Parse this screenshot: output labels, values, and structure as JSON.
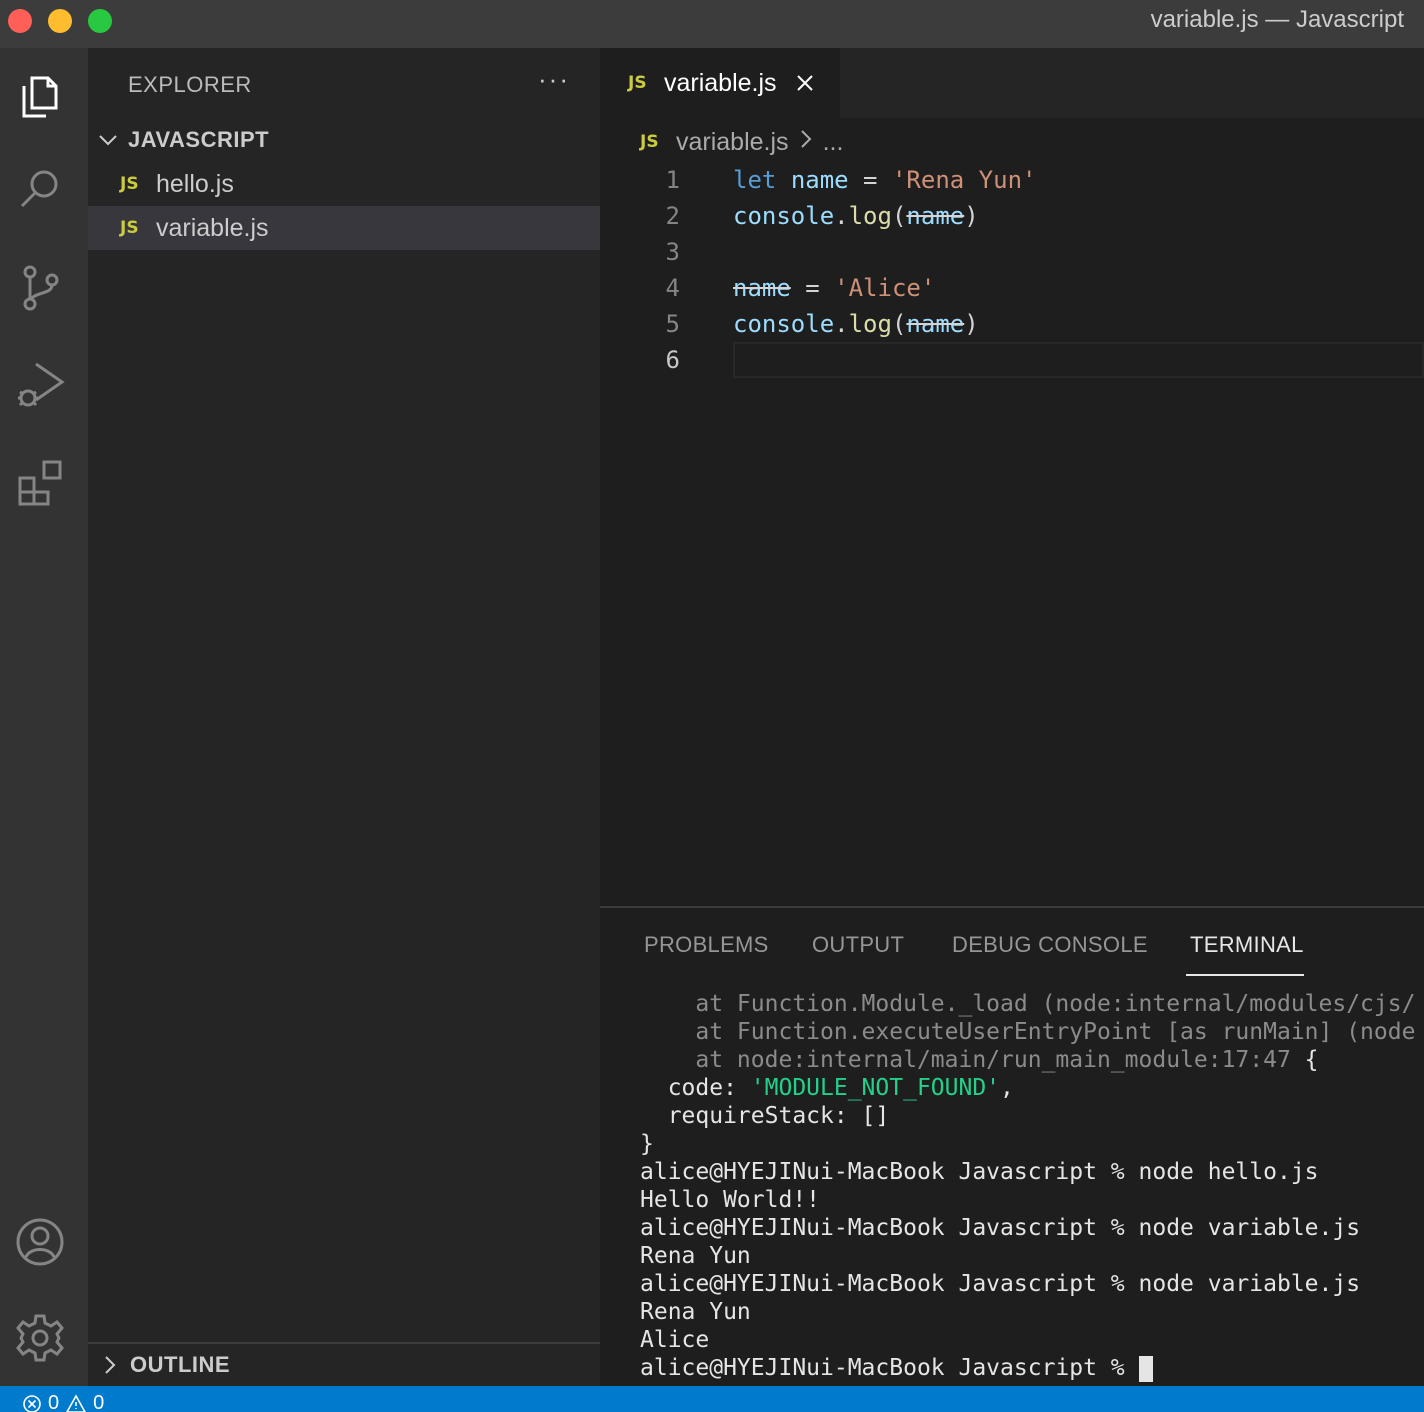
{
  "window": {
    "title": "variable.js — Javascript"
  },
  "sidebar": {
    "header": "EXPLORER",
    "more": "···",
    "folder": "JAVASCRIPT",
    "files": [
      {
        "badge": "JS",
        "name": "hello.js"
      },
      {
        "badge": "JS",
        "name": "variable.js"
      }
    ],
    "outline": "OUTLINE"
  },
  "editor": {
    "tab": {
      "badge": "JS",
      "name": "variable.js"
    },
    "breadcrumb": {
      "badge": "JS",
      "file": "variable.js",
      "rest": "..."
    },
    "line_numbers": [
      "1",
      "2",
      "3",
      "4",
      "5",
      "6"
    ],
    "code": {
      "l1": {
        "kw": "let",
        "var": "name",
        "op": " = ",
        "str": "'Rena Yun'"
      },
      "l2": {
        "obj": "console",
        "dot": ".",
        "fn": "log",
        "open": "(",
        "arg": "name",
        "close": ")"
      },
      "l4": {
        "var": "name",
        "op": " = ",
        "str": "'Alice'"
      },
      "l5": {
        "obj": "console",
        "dot": ".",
        "fn": "log",
        "open": "(",
        "arg": "name",
        "close": ")"
      }
    }
  },
  "panel": {
    "tabs": [
      "PROBLEMS",
      "OUTPUT",
      "DEBUG CONSOLE",
      "TERMINAL"
    ],
    "active_tab": "TERMINAL",
    "terminal": {
      "l1": "    at Function.Module._load (node:internal/modules/cjs/",
      "l2": "    at Function.executeUserEntryPoint [as runMain] (node",
      "l3a": "    at node:internal/main/run_main_module:17:47",
      "l3b": " {",
      "l4a": "  code: ",
      "l4b": "'MODULE_NOT_FOUND'",
      "l4c": ",",
      "l5": "  requireStack: []",
      "l6": "}",
      "l7": "alice@HYEJINui-MacBook Javascript % node hello.js",
      "l8": "Hello World!!",
      "l9": "alice@HYEJINui-MacBook Javascript % node variable.js",
      "l10": "Rena Yun",
      "l11": "alice@HYEJINui-MacBook Javascript % node variable.js",
      "l12": "Rena Yun",
      "l13": "Alice",
      "l14": "alice@HYEJINui-MacBook Javascript % "
    }
  },
  "status": {
    "errors": "0",
    "warnings": "0"
  }
}
